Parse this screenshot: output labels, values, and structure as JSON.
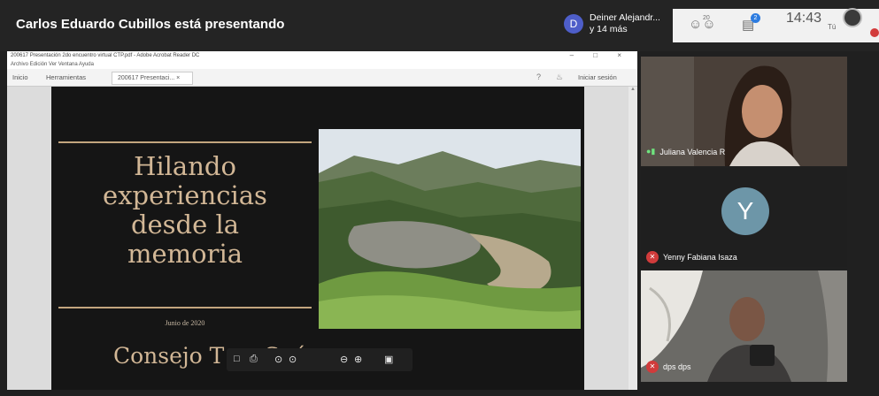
{
  "header": {
    "presenter_text": "Carlos Eduardo Cubillos está presentando",
    "participant_initial": "D",
    "participant_name": "Deiner Alejandr...",
    "participant_more": "y 14 más",
    "people_count": "20",
    "chat_badge": "2",
    "clock": "14:43",
    "self_label": "Tú"
  },
  "acrobat": {
    "window_title": "200617 Presentación 2do encuentro virtual CTP.pdf - Adobe Acrobat Reader DC",
    "menu": "Archivo  Edición  Ver  Ventana  Ayuda",
    "tabs": [
      "Inicio",
      "Herramientas"
    ],
    "doc_tab": "200617 Presentaci... ×",
    "signin": "Iniciar sesión"
  },
  "slide": {
    "title_lines": [
      "Hilando",
      "experiencias",
      "desde la",
      "memoria"
    ],
    "date": "Junio de 2020",
    "footer": "Consejo T              z - Suárez"
  },
  "participants": [
    {
      "name": "Juliana Valencia R"
    },
    {
      "name": "Yenny Fabiana Isaza",
      "initial": "Y"
    },
    {
      "name": "dps dps"
    }
  ],
  "colors": {
    "slide_gold": "#d2b796",
    "avatar_blue": "#4e5ec9",
    "y_avatar": "#6d96a8",
    "muted_red": "#d13b3b",
    "chat_blue": "#2d7ce0"
  },
  "icons": [
    "people-icon",
    "chat-icon",
    "help-icon",
    "bell-icon",
    "mic-on-icon",
    "mic-off-icon"
  ]
}
